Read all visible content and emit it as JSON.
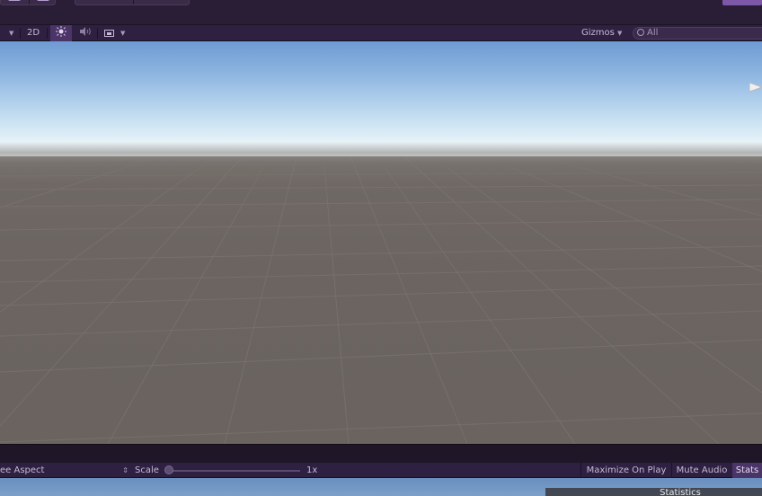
{
  "scene_toolbar": {
    "mode_2d": "2D",
    "gizmos": "Gizmos",
    "search_placeholder": "All"
  },
  "game_toolbar": {
    "aspect": "ee Aspect",
    "scale_label": "Scale",
    "scale_value": "1x",
    "maximize_on_play": "Maximize On Play",
    "mute_audio": "Mute Audio",
    "stats": "Stats"
  },
  "stats_panel": {
    "title": "Statistics"
  },
  "icons": {
    "lighting": "sun-icon",
    "audio": "speaker-icon",
    "effects": "image-icon",
    "search": "search-icon",
    "scene_gizmo": "scene-gizmo-cone"
  },
  "colors": {
    "toolbar_bg": "#2e2040",
    "accent": "#4a3468",
    "sky_top": "#6e9bd3",
    "ground": "#6b6460"
  }
}
